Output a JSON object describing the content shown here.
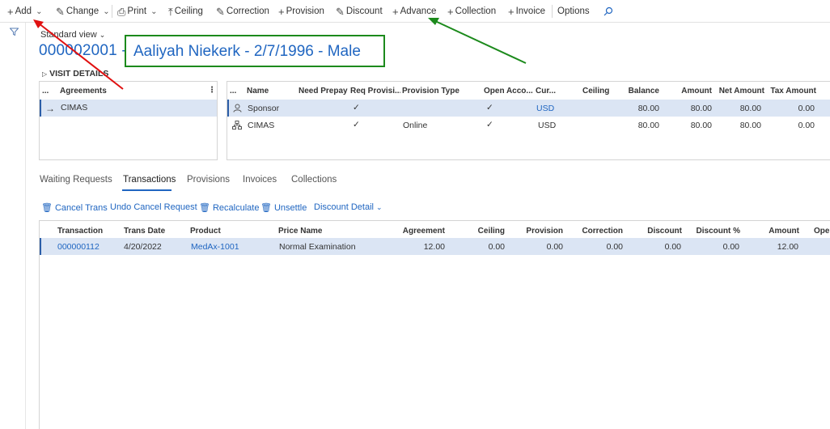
{
  "toolbar": {
    "add": "Add",
    "change": "Change",
    "print": "Print",
    "ceiling": "Ceiling",
    "correction": "Correction",
    "provision": "Provision",
    "discount": "Discount",
    "advance": "Advance",
    "collection": "Collection",
    "invoice": "Invoice",
    "options": "Options"
  },
  "page": {
    "view": "Standard view",
    "id_title": "000002001 -",
    "patient": "Aaliyah Niekerk - 2/7/1996 - Male",
    "visit_details": "VISIT DETAILS"
  },
  "agreements": {
    "header": "Agreements",
    "rows": [
      {
        "name": "CIMAS"
      }
    ]
  },
  "provision_grid": {
    "headers": [
      "...",
      "Name",
      "Need Prepay",
      "Req Provisi...",
      "Provision Type",
      "Open Acco...",
      "Cur...",
      "Ceiling",
      "Balance",
      "Amount",
      "Net Amount",
      "Tax Amount"
    ],
    "rows": [
      {
        "name": "Sponsor",
        "req": "✓",
        "ptype": "",
        "open": "✓",
        "cur": "USD",
        "balance": "80.00",
        "amount": "80.00",
        "net": "80.00",
        "tax": "0.00"
      },
      {
        "name": "CIMAS",
        "req": "✓",
        "ptype": "Online",
        "open": "✓",
        "cur": "USD",
        "balance": "80.00",
        "amount": "80.00",
        "net": "80.00",
        "tax": "0.00"
      }
    ]
  },
  "tabs": [
    "Waiting Requests",
    "Transactions",
    "Provisions",
    "Invoices",
    "Collections"
  ],
  "actions": {
    "cancel_trans": "Cancel Trans",
    "undo_cancel": "Undo Cancel Request",
    "recalculate": "Recalculate",
    "unsettle": "Unsettle",
    "discount_detail": "Discount Detail"
  },
  "trans_grid": {
    "headers": [
      "Transaction",
      "Trans Date",
      "Product",
      "Price Name",
      "Agreement",
      "Ceiling",
      "Provision",
      "Correction",
      "Discount",
      "Discount %",
      "Amount",
      "Oper"
    ],
    "rows": [
      {
        "transaction": "000000112",
        "date": "4/20/2022",
        "product": "MedAx-1001",
        "price_name": "Normal Examination",
        "agreement": "12.00",
        "ceiling": "0.00",
        "provision": "0.00",
        "correction": "0.00",
        "discount": "0.00",
        "discount_pct": "0.00",
        "amount": "12.00"
      }
    ]
  },
  "colors": {
    "accent": "#2066c1",
    "highlight_box": "#1c8a1c",
    "arrow_red": "#e01010",
    "arrow_green": "#1c8a1c",
    "selected_row": "#dbe5f4"
  }
}
